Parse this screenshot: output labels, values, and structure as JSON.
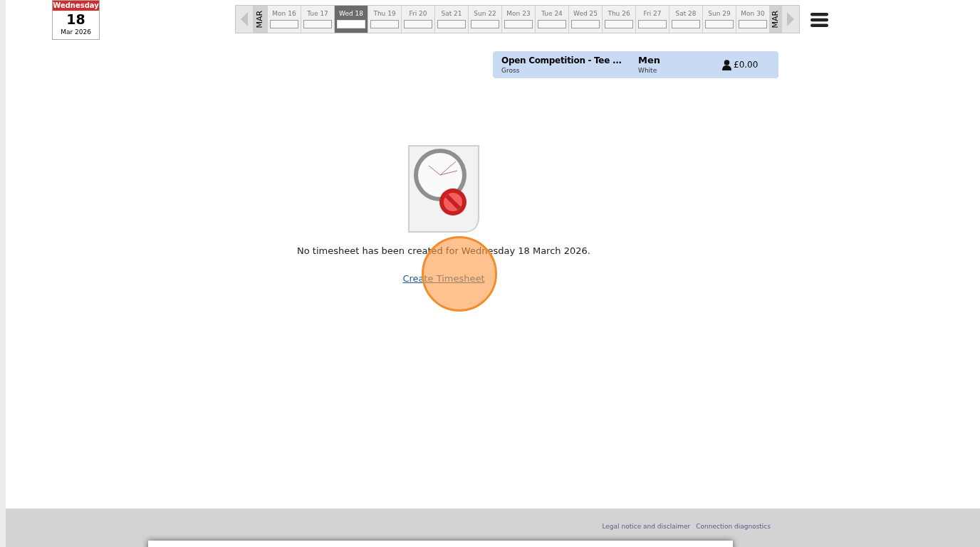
{
  "date_card": {
    "weekday": "Wednesday",
    "day": "18",
    "month_year": "Mar 2026"
  },
  "day_strip": {
    "month_left": "MAR",
    "month_right": "MAR",
    "days": [
      {
        "label": "Mon 16",
        "selected": false
      },
      {
        "label": "Tue 17",
        "selected": false
      },
      {
        "label": "Wed 18",
        "selected": true
      },
      {
        "label": "Thu 19",
        "selected": false
      },
      {
        "label": "Fri 20",
        "selected": false
      },
      {
        "label": "Sat 21",
        "selected": false
      },
      {
        "label": "Sun 22",
        "selected": false
      },
      {
        "label": "Mon 23",
        "selected": false
      },
      {
        "label": "Tue 24",
        "selected": false
      },
      {
        "label": "Wed 25",
        "selected": false
      },
      {
        "label": "Thu 26",
        "selected": false
      },
      {
        "label": "Fri 27",
        "selected": false
      },
      {
        "label": "Sat 28",
        "selected": false
      },
      {
        "label": "Sun 29",
        "selected": false
      },
      {
        "label": "Mon 30",
        "selected": false
      }
    ]
  },
  "event": {
    "title": "Open Competition - Tee ...",
    "subtitle": "Gross",
    "category": "Men",
    "tee": "White",
    "price": "£0.00"
  },
  "empty_state": {
    "message": "No timesheet has been created for Wednesday 18 March 2026.",
    "link": "Create Timesheet"
  },
  "footer": {
    "links": [
      "Legal notice and disclaimer",
      "Connection diagnostics"
    ]
  }
}
